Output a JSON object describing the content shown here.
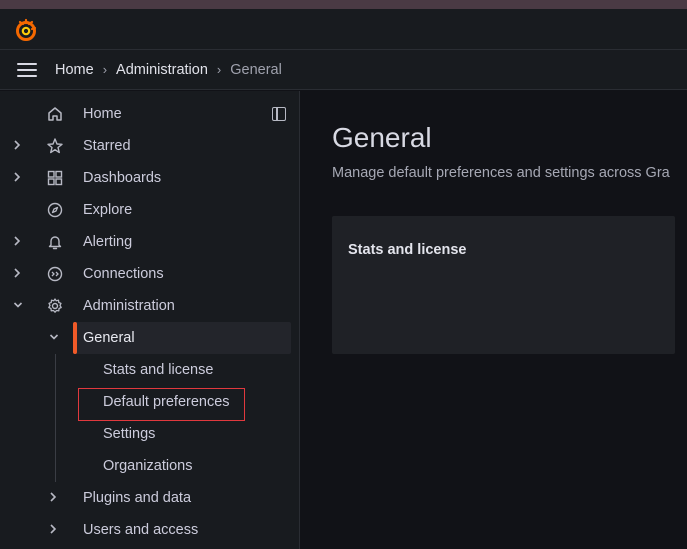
{
  "breadcrumb": {
    "home": "Home",
    "admin": "Administration",
    "current": "General",
    "separator": "›"
  },
  "nav": {
    "items": [
      {
        "label": "Home",
        "icon": "home-icon"
      },
      {
        "label": "Starred",
        "icon": "star-icon"
      },
      {
        "label": "Dashboards",
        "icon": "dashboards-icon"
      },
      {
        "label": "Explore",
        "icon": "compass-icon"
      },
      {
        "label": "Alerting",
        "icon": "bell-icon"
      },
      {
        "label": "Connections",
        "icon": "connections-icon"
      },
      {
        "label": "Administration",
        "icon": "gear-icon"
      }
    ],
    "admin_children": {
      "general": "General",
      "general_children": [
        "Stats and license",
        "Default preferences",
        "Settings",
        "Organizations"
      ],
      "plugins": "Plugins and data",
      "users": "Users and access"
    }
  },
  "main": {
    "title": "General",
    "subtitle": "Manage default preferences and settings across Gra",
    "card_title": "Stats and license"
  },
  "colors": {
    "accent": "#f05a28",
    "highlight": "#e0393e",
    "background": "#111217",
    "panel": "#181b1f"
  }
}
